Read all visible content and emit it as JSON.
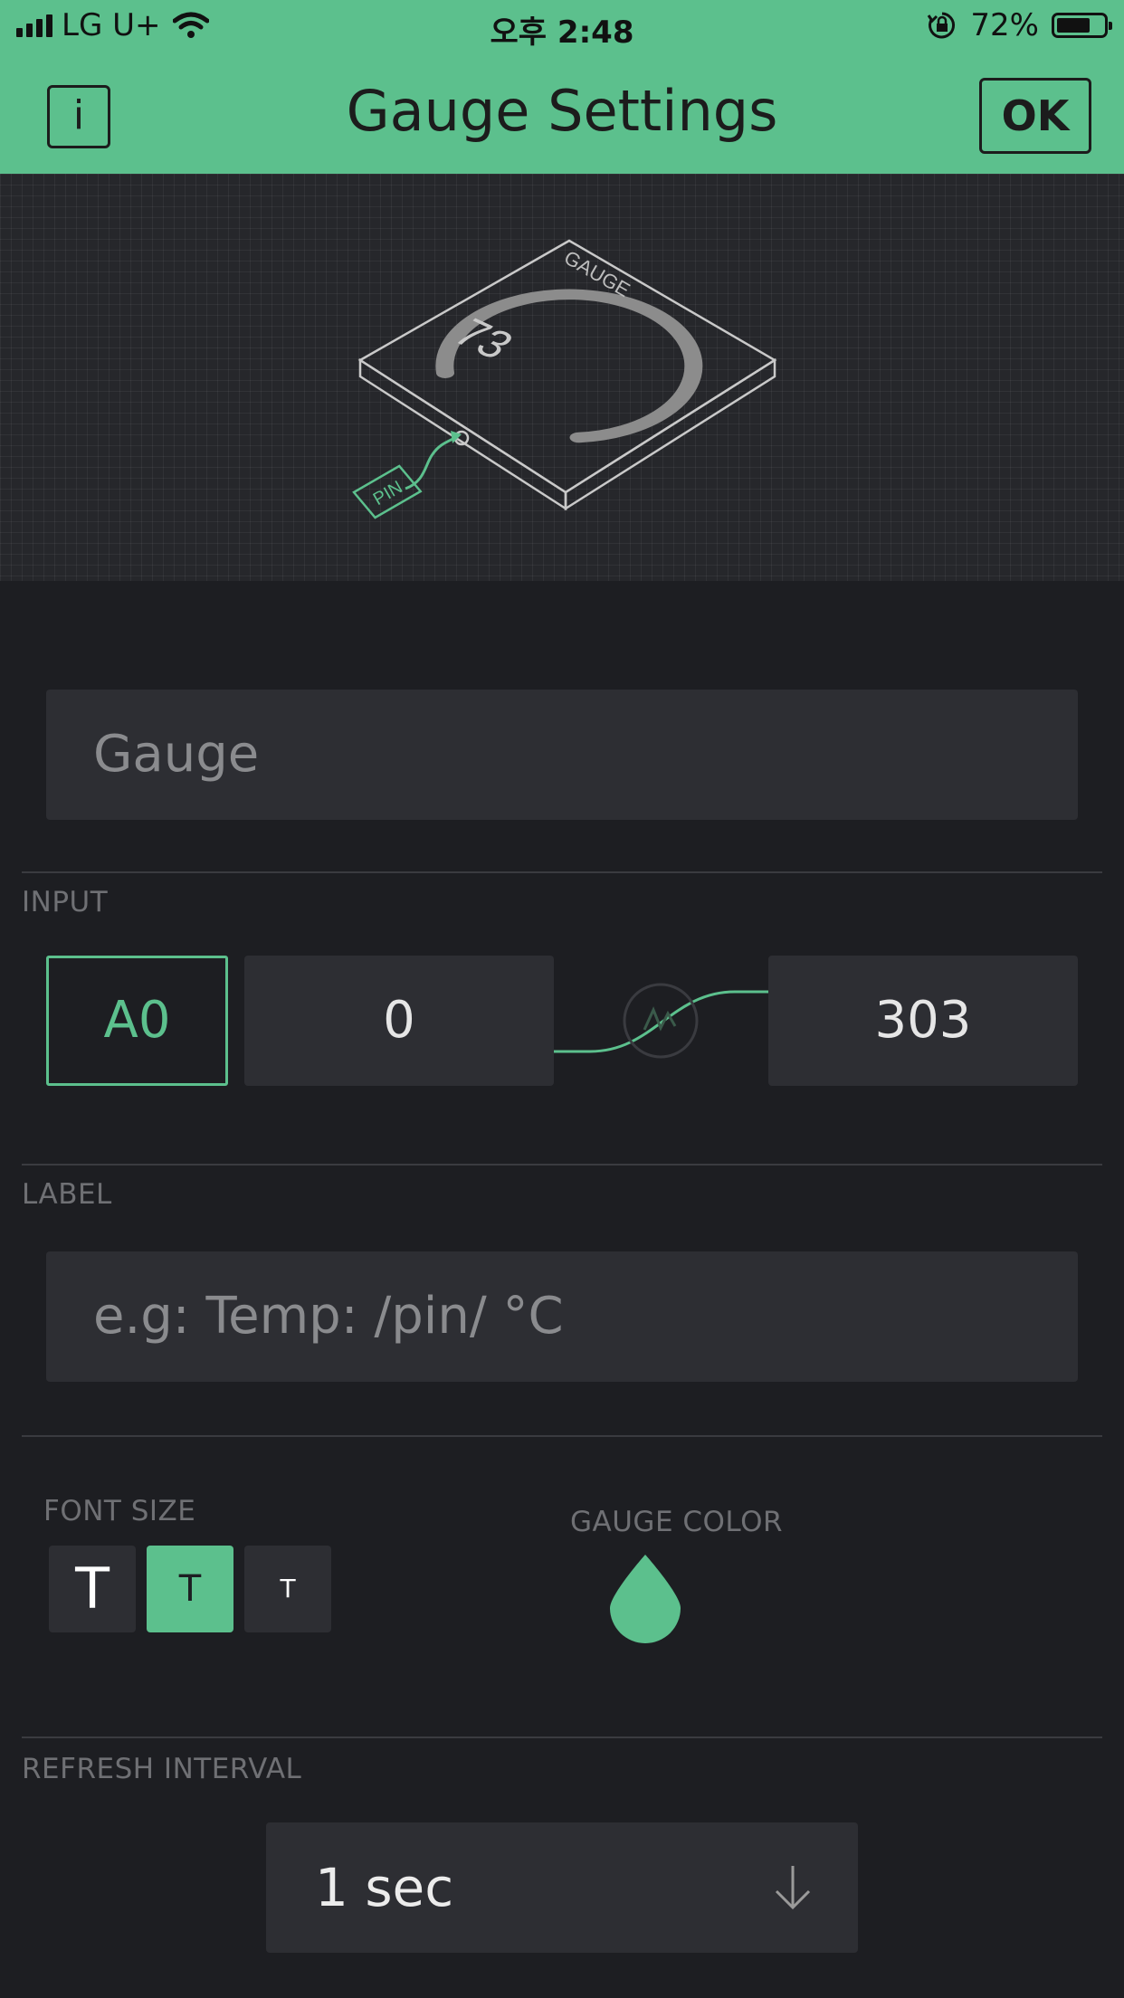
{
  "status_bar": {
    "carrier": "LG U+",
    "time": "오후 2:48",
    "battery_percent": "72%",
    "battery_level": 0.72
  },
  "header": {
    "info_label": "i",
    "title": "Gauge Settings",
    "ok_label": "OK"
  },
  "preview": {
    "widget_name": "GAUGE",
    "value": "73",
    "pin_label": "PIN"
  },
  "name_field": {
    "placeholder": "Gauge"
  },
  "input": {
    "section_label": "INPUT",
    "pin": "A0",
    "min": "0",
    "max": "303"
  },
  "label": {
    "section_label": "LABEL",
    "placeholder": "e.g: Temp: /pin/ °C"
  },
  "font_size": {
    "section_label": "FONT SIZE",
    "options": [
      "T",
      "T",
      "T"
    ],
    "selected_index": 1
  },
  "gauge_color": {
    "section_label": "GAUGE COLOR",
    "color": "#5cc08d"
  },
  "refresh_interval": {
    "section_label": "REFRESH INTERVAL",
    "value": "1 sec"
  },
  "colors": {
    "accent": "#5cc08d",
    "background": "#1d1e22",
    "field": "#2d2e33"
  }
}
